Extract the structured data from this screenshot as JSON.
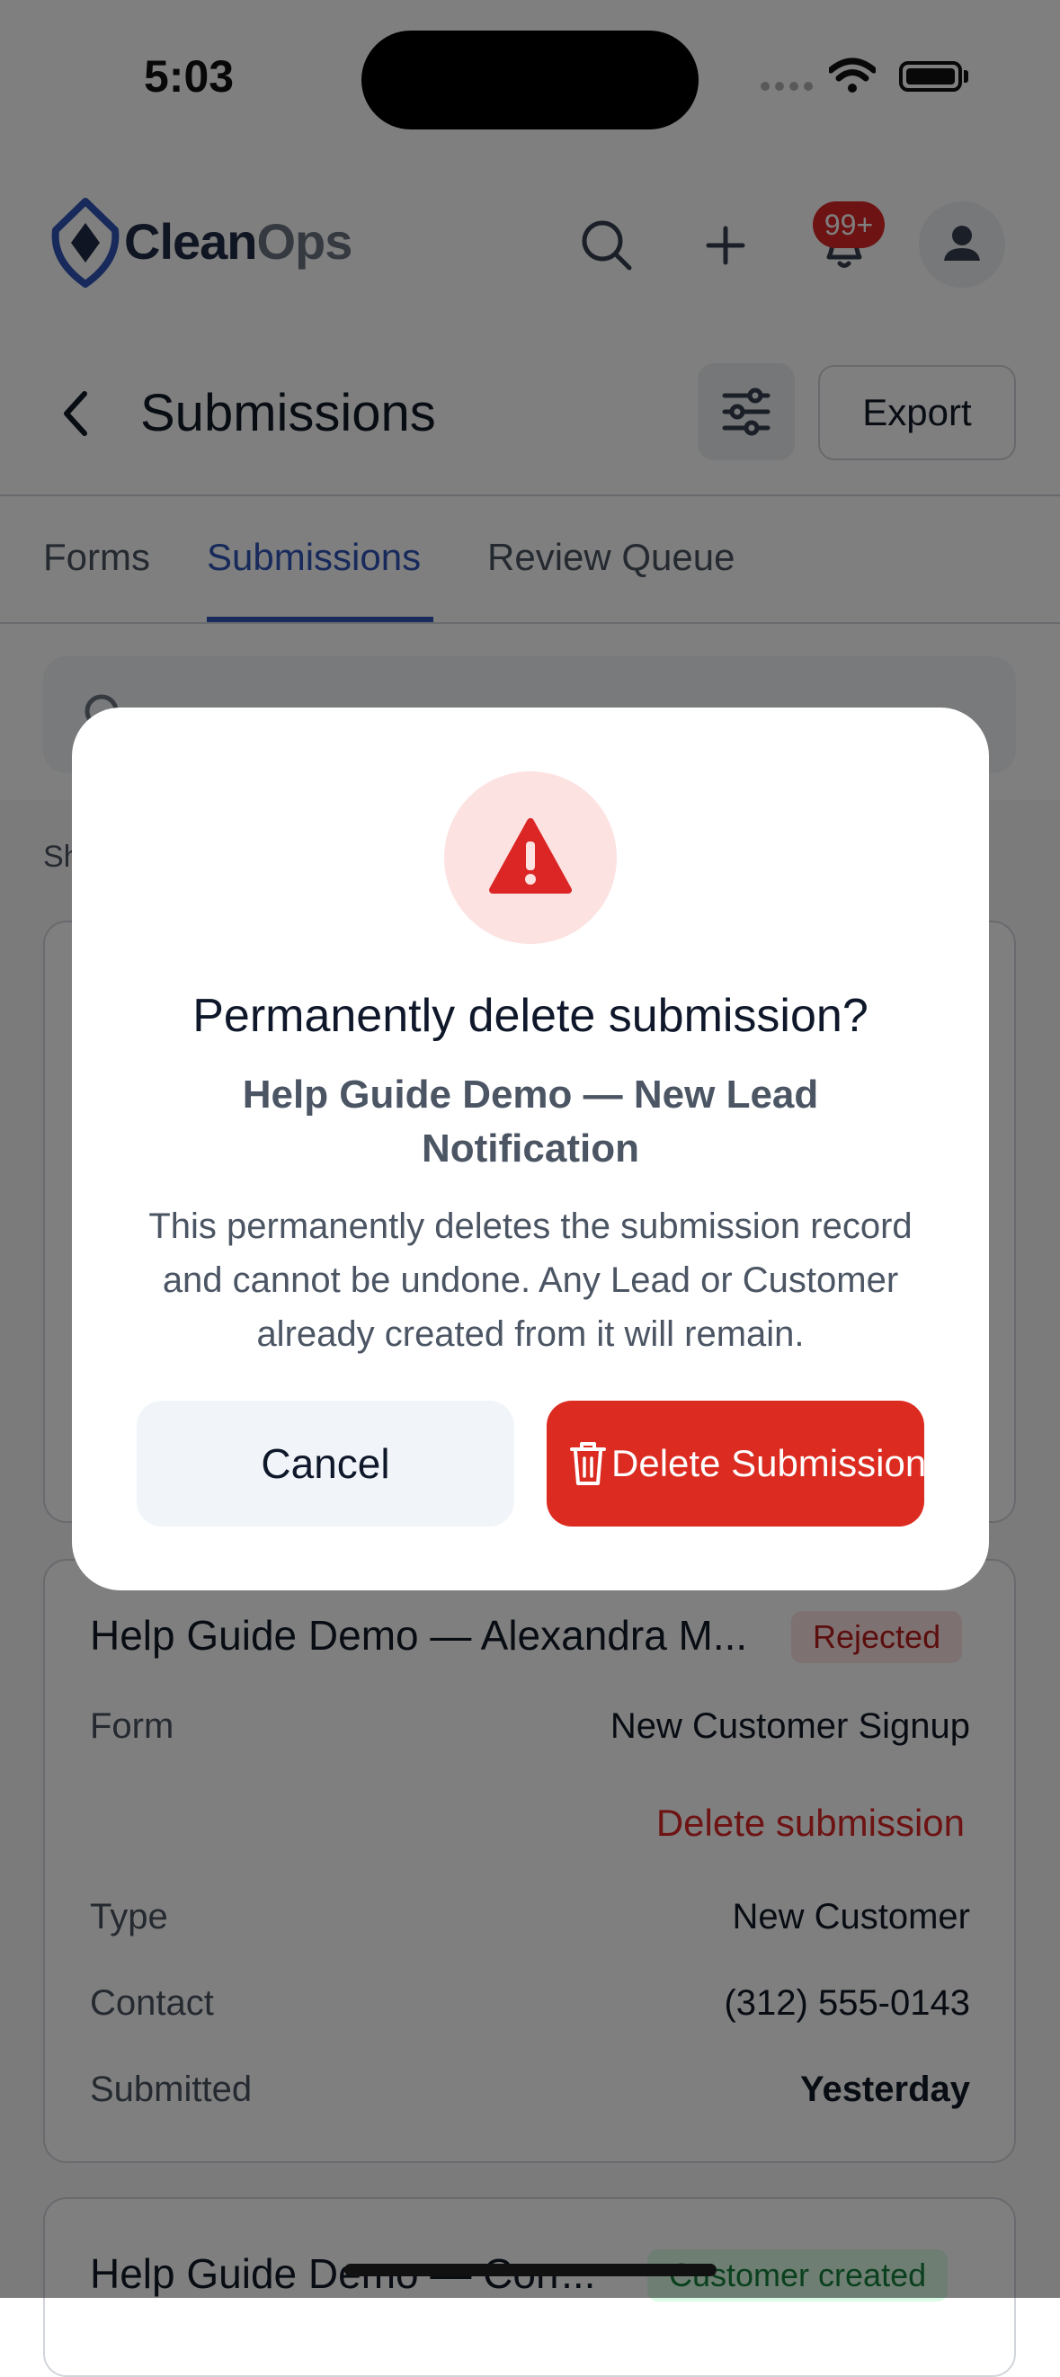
{
  "status_bar": {
    "time": "5:03"
  },
  "header": {
    "logo_part1": "Clean",
    "logo_part2": "Ops",
    "notification_count": "99+"
  },
  "page": {
    "title": "Submissions",
    "export_label": "Export"
  },
  "tabs": [
    {
      "label": "Forms"
    },
    {
      "label": "Submissions"
    },
    {
      "label": "Review Queue"
    }
  ],
  "list": {
    "showing_prefix": "Sh",
    "cards": [
      {
        "title": "Help Guide Demo — Alexandra M...",
        "status": "Rejected",
        "rows": [
          {
            "label": "Form",
            "value": "New Customer Signup"
          },
          {
            "label": "Type",
            "value": "New Customer"
          },
          {
            "label": "Contact",
            "value": "(312) 555-0143"
          },
          {
            "label": "Submitted",
            "value": "Yesterday"
          }
        ],
        "delete_label": "Delete submission"
      },
      {
        "title": "Help Guide Demo — Corr...",
        "status": "Customer created"
      }
    ]
  },
  "dialog": {
    "title": "Permanently delete submission?",
    "subtitle": "Help Guide Demo — New Lead Notification",
    "body": "This permanently deletes the submission record and cannot be undone. Any Lead or Customer already created from it will remain.",
    "cancel_label": "Cancel",
    "delete_label": "Delete Submission"
  },
  "colors": {
    "brand_blue": "#2f55b7",
    "danger": "#dc2b20",
    "overlay": "rgba(0,0,0,0.5)"
  },
  "icons": [
    "wifi-icon",
    "battery-icon",
    "search-icon",
    "plus-icon",
    "bell-icon",
    "user-icon",
    "chevron-left-icon",
    "sliders-icon",
    "warning-icon",
    "trash-icon"
  ]
}
